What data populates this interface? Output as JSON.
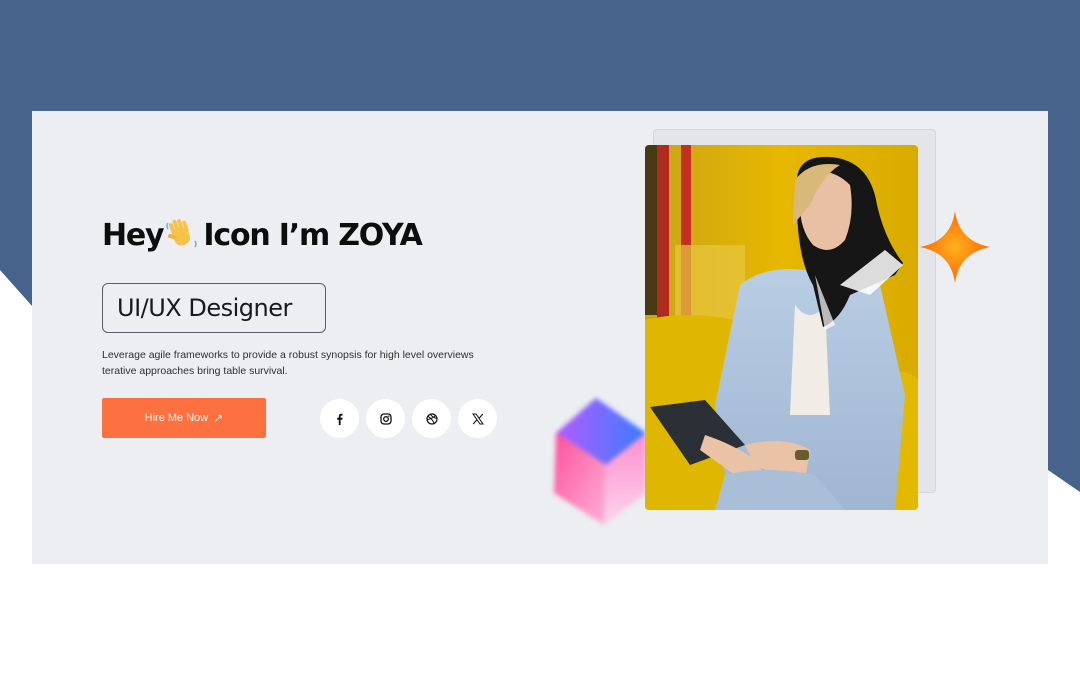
{
  "hero": {
    "headline_prefix": "Hey",
    "headline_suffix": "Icon I’m ZOYA",
    "role": "UI/UX Designer",
    "description_line1": "Leverage agile frameworks to provide a robust synopsis for high level overviews",
    "description_line2": "terative approaches bring table survival.",
    "cta_label": "Hire Me Now",
    "cta_arrow": "↗"
  },
  "social": [
    {
      "name": "facebook-icon",
      "glyph": "f"
    },
    {
      "name": "instagram-icon",
      "glyph": ""
    },
    {
      "name": "dribbble-icon",
      "glyph": ""
    },
    {
      "name": "x-icon",
      "glyph": "𝕏"
    }
  ],
  "colors": {
    "top_band": "#47638c",
    "card": "#eceef1",
    "accent": "#fd7040",
    "sparkle": "#ff7a10"
  }
}
